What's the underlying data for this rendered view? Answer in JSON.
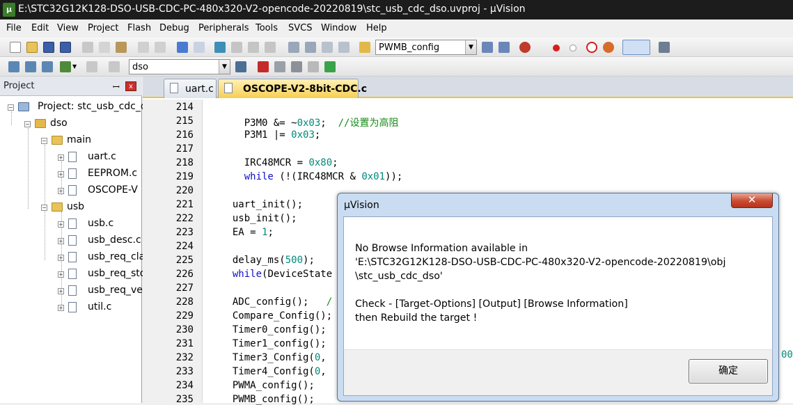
{
  "window": {
    "title": "E:\\STC32G12K128-DSO-USB-CDC-PC-480x320-V2-opencode-20220819\\stc_usb_cdc_dso.uvproj - µVision",
    "app_icon": "uvision-app-icon"
  },
  "menu": [
    "File",
    "Edit",
    "View",
    "Project",
    "Flash",
    "Debug",
    "Peripherals",
    "Tools",
    "SVCS",
    "Window",
    "Help"
  ],
  "toolbar1": {
    "function_combo": "PWMB_config"
  },
  "toolbar2": {
    "target_combo": "dso"
  },
  "project_panel": {
    "title": "Project",
    "tree": {
      "root": "Project: stc_usb_cdc_d",
      "target": "dso",
      "groups": [
        {
          "name": "main",
          "files": [
            "uart.c",
            "EEPROM.c",
            "OSCOPE-V"
          ]
        },
        {
          "name": "usb",
          "files": [
            "usb.c",
            "usb_desc.c",
            "usb_req_cla",
            "usb_req_std",
            "usb_req_ve",
            "util.c"
          ]
        }
      ]
    }
  },
  "editor": {
    "tabs": [
      {
        "label": "uart.c",
        "active": false
      },
      {
        "label": "OSCOPE-V2-8bit-CDC.c",
        "active": true
      }
    ],
    "line_numbers": [
      "214",
      "215",
      "216",
      "217",
      "218",
      "219",
      "220",
      "221",
      "222",
      "223",
      "224",
      "225",
      "226",
      "227",
      "228",
      "229",
      "230",
      "231",
      "232",
      "233",
      "234",
      "235"
    ],
    "lines": [
      [],
      [
        {
          "t": "    P3M0 &= ~"
        },
        {
          "t": "0x03",
          "c": "num"
        },
        {
          "t": ";  "
        },
        {
          "t": "//设置为高阻",
          "c": "cm"
        }
      ],
      [
        {
          "t": "    P3M1 |= "
        },
        {
          "t": "0x03",
          "c": "num"
        },
        {
          "t": ";"
        }
      ],
      [],
      [
        {
          "t": "    IRC48MCR = "
        },
        {
          "t": "0x80",
          "c": "num"
        },
        {
          "t": ";"
        }
      ],
      [
        {
          "t": "    "
        },
        {
          "t": "while",
          "c": "kw"
        },
        {
          "t": " (!(IRC48MCR & "
        },
        {
          "t": "0x01",
          "c": "num"
        },
        {
          "t": "));"
        }
      ],
      [],
      [
        {
          "t": "  uart_init();"
        }
      ],
      [
        {
          "t": "  usb_init();"
        }
      ],
      [
        {
          "t": "  EA = "
        },
        {
          "t": "1",
          "c": "num"
        },
        {
          "t": ";"
        }
      ],
      [],
      [
        {
          "t": "  delay_ms("
        },
        {
          "t": "500",
          "c": "num"
        },
        {
          "t": ");"
        }
      ],
      [
        {
          "t": "  "
        },
        {
          "t": "while",
          "c": "kw"
        },
        {
          "t": "(DeviceState"
        }
      ],
      [],
      [
        {
          "t": "  ADC_config();   "
        },
        {
          "t": "/",
          "c": "cm"
        }
      ],
      [
        {
          "t": "  Compare_Config();"
        }
      ],
      [
        {
          "t": "  Timer0_config();"
        }
      ],
      [
        {
          "t": "  Timer1_config();"
        }
      ],
      [
        {
          "t": "  Timer3_Config("
        },
        {
          "t": "0",
          "c": "num"
        },
        {
          "t": ","
        }
      ],
      [
        {
          "t": "  Timer4_Config("
        },
        {
          "t": "0",
          "c": "num"
        },
        {
          "t": ","
        }
      ],
      [
        {
          "t": "  PWMA_config();"
        }
      ],
      [
        {
          "t": "  PWMB_config();"
        }
      ]
    ],
    "right_edge_fragment": "00"
  },
  "dialog": {
    "title": "µVision",
    "close_glyph": "✕",
    "message_lines": [
      "No Browse Information available in",
      "'E:\\STC32G12K128-DSO-USB-CDC-PC-480x320-V2-opencode-20220819\\obj",
      "\\stc_usb_cdc_dso'",
      "",
      "Check - [Target-Options] [Output] [Browse Information]",
      "then Rebuild the target !"
    ],
    "ok_label": "确定"
  }
}
